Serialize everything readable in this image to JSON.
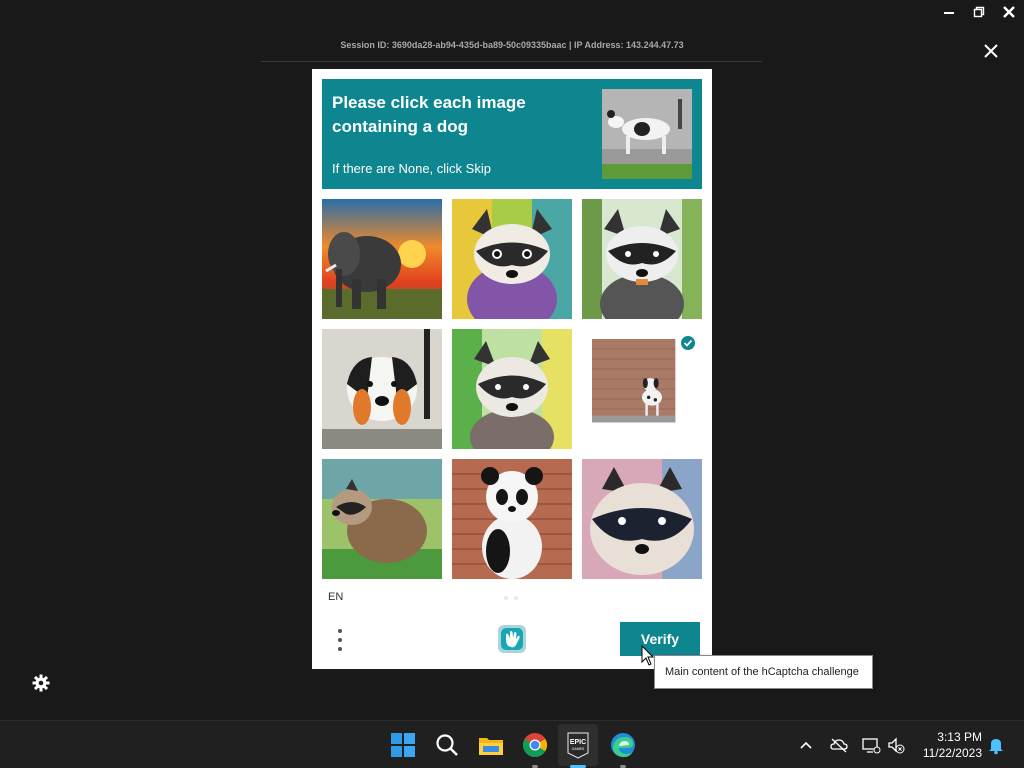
{
  "session_info": "Session ID: 3690da28-ab94-435d-ba89-50c09335baac | IP Address: 143.244.47.73",
  "captcha": {
    "prompt_title": "Please click each image containing a dog",
    "prompt_subtitle": "If there are None, click Skip",
    "language": "EN",
    "verify_label": "Verify",
    "tiles": [
      {
        "subject": "elephant at sunset",
        "selected": false
      },
      {
        "subject": "raccoon watercolor",
        "selected": false
      },
      {
        "subject": "raccoon in forest",
        "selected": false
      },
      {
        "subject": "dog mural",
        "selected": false
      },
      {
        "subject": "raccoon watercolor",
        "selected": false
      },
      {
        "subject": "dalmatian-like dog by brick wall",
        "selected": true
      },
      {
        "subject": "raccoon sitting",
        "selected": false
      },
      {
        "subject": "panda on brick wall",
        "selected": false
      },
      {
        "subject": "raccoon close-up",
        "selected": false
      }
    ]
  },
  "tooltip": "Main content of the hCaptcha challenge",
  "taskbar": {
    "time": "3:13 PM",
    "date": "11/22/2023"
  },
  "colors": {
    "accent": "#0e8690",
    "background": "#191919",
    "taskbar": "#202020"
  }
}
